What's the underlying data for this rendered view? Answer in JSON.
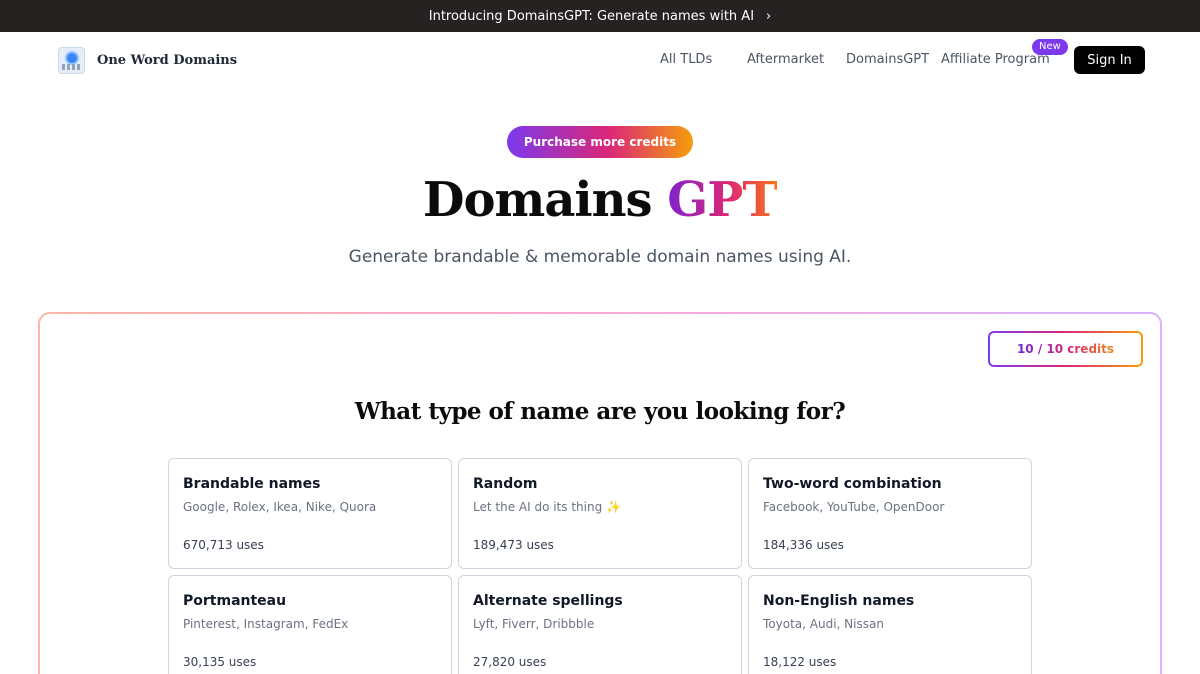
{
  "announcement": {
    "text": "Introducing DomainsGPT: Generate names with AI",
    "chevron": "›",
    "chevron_icon": "chevron-right-icon"
  },
  "nav": {
    "logo_text": "One Word Domains",
    "links": [
      "All TLDs",
      "Aftermarket",
      "DomainsGPT",
      "Affiliate Program"
    ],
    "new_badge": "New",
    "sign_in": "Sign In"
  },
  "hero": {
    "purchase_button": "Purchase more credits",
    "title_main": "Domains",
    "title_accent": "GPT",
    "subtitle": "Generate brandable & memorable domain names using AI."
  },
  "panel": {
    "credits": "10 / 10 credits",
    "question": "What type of name are you looking for?",
    "cards": [
      {
        "title": "Brandable names",
        "examples": "Google, Rolex, Ikea, Nike, Quora",
        "uses": "670,713 uses"
      },
      {
        "title": "Random",
        "examples": "Let the AI do its thing ✨",
        "uses": "189,473 uses"
      },
      {
        "title": "Two-word combination",
        "examples": "Facebook, YouTube, OpenDoor",
        "uses": "184,336 uses"
      },
      {
        "title": "Portmanteau",
        "examples": "Pinterest, Instagram, FedEx",
        "uses": "30,135 uses"
      },
      {
        "title": "Alternate spellings",
        "examples": "Lyft, Fiverr, Dribbble",
        "uses": "27,820 uses"
      },
      {
        "title": "Non-English names",
        "examples": "Toyota, Audi, Nissan",
        "uses": "18,122 uses"
      }
    ]
  },
  "colors": {
    "announcement_bg": "#272222",
    "accent_purple": "#7c3aed",
    "accent_pink": "#db2777",
    "accent_orange": "#f59e0b",
    "sign_in_bg": "#000000"
  }
}
